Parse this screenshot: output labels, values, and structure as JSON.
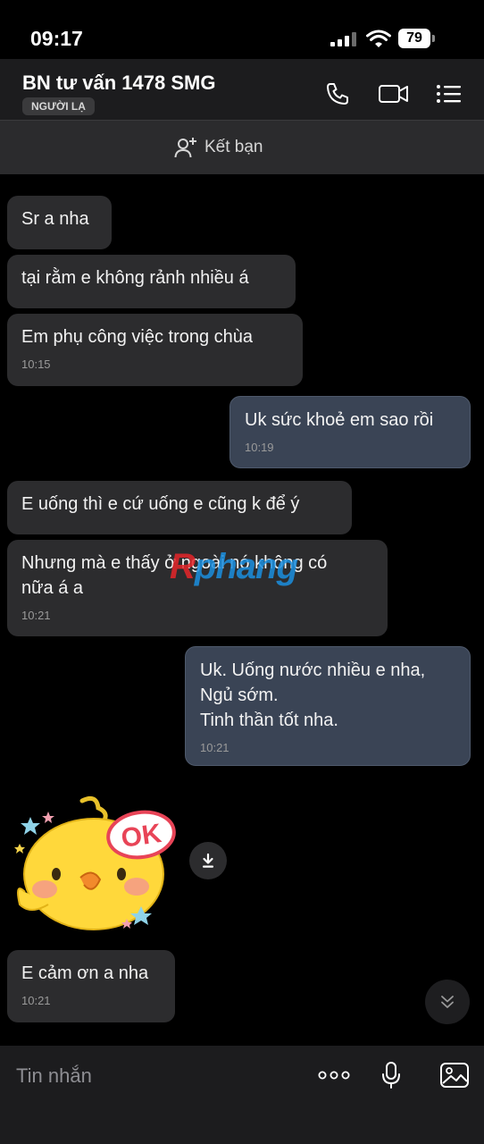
{
  "status_bar": {
    "time": "09:17",
    "battery": "79"
  },
  "header": {
    "contact_name": "BN tư vấn 1478 SMG",
    "badge": "NGƯỜI LẠ"
  },
  "friend_bar": {
    "label": "Kết bạn"
  },
  "messages": [
    {
      "text": "Sr a nha",
      "time": ""
    },
    {
      "text": "tại rằm e không rảnh nhiều á",
      "time": ""
    },
    {
      "text": "Em phụ công việc trong chùa",
      "time": "10:15"
    },
    {
      "text": "Uk sức khoẻ em sao rồi",
      "time": "10:19"
    },
    {
      "text": "E uống thì e cứ uống e cũng k để ý",
      "time": ""
    },
    {
      "text": "Nhưng mà e thấy ở ngoài nó không có\nnữa á a",
      "time": "10:21"
    },
    {
      "text": "Uk. Uống nước nhiều e nha,\nNgủ sớm.\nTinh thần tốt nha.",
      "time": "10:21"
    },
    {
      "text": "E cảm ơn a nha",
      "time": "10:21"
    }
  ],
  "watermark": {
    "part_a": "R",
    "part_b": "phang"
  },
  "sticker": {
    "text": "OK"
  },
  "input": {
    "placeholder": "Tin nhắn"
  },
  "colors": {
    "incoming_bg": "#2c2c2e",
    "outgoing_bg": "#3a4455",
    "background": "#000000",
    "header_bg": "#1c1c1e"
  },
  "icons": [
    "phone-icon",
    "video-icon",
    "menu-icon",
    "add-friend-icon",
    "download-icon",
    "chevron-double-down-icon",
    "more-icon",
    "microphone-icon",
    "image-icon"
  ]
}
